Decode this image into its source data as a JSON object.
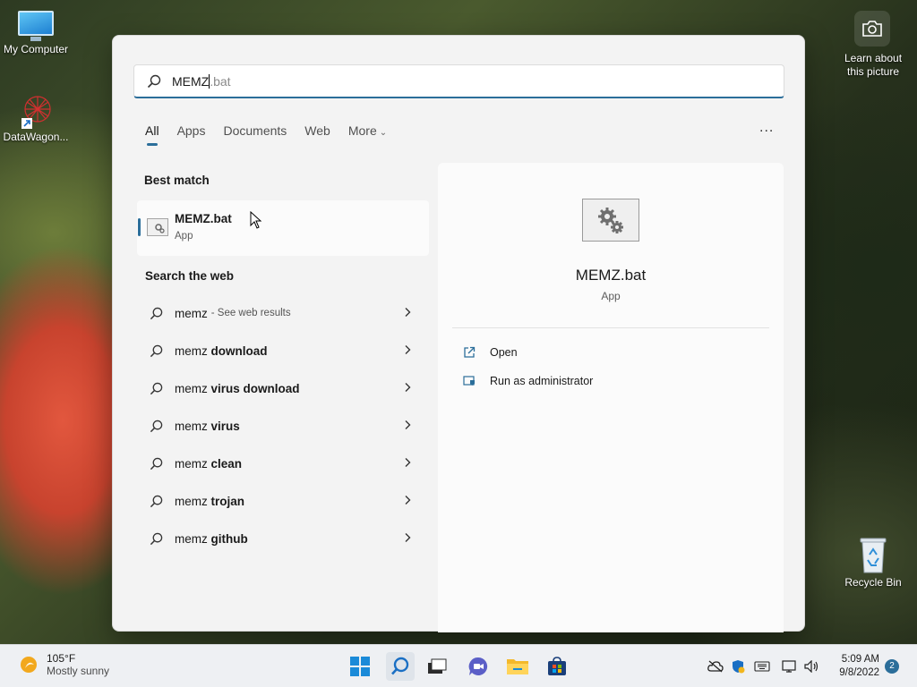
{
  "desktop": {
    "icons": [
      {
        "label": "My Computer"
      },
      {
        "label": "DataWagon..."
      },
      {
        "label": "Recycle Bin"
      }
    ],
    "camera": {
      "label_line1": "Learn about",
      "label_line2": "this picture"
    }
  },
  "search": {
    "typed": "MEMZ",
    "suggestion": ".bat",
    "tabs": [
      "All",
      "Apps",
      "Documents",
      "Web",
      "More"
    ],
    "active_tab": "All",
    "more_menu": "..."
  },
  "best_match": {
    "heading": "Best match",
    "name": "MEMZ.bat",
    "type": "App"
  },
  "web": {
    "heading": "Search the web",
    "results": [
      {
        "query": "memz",
        "bold": "",
        "hint": "- See web results"
      },
      {
        "query": "memz ",
        "bold": "download",
        "hint": ""
      },
      {
        "query": "memz ",
        "bold": "virus download",
        "hint": ""
      },
      {
        "query": "memz ",
        "bold": "virus",
        "hint": ""
      },
      {
        "query": "memz ",
        "bold": "clean",
        "hint": ""
      },
      {
        "query": "memz ",
        "bold": "trojan",
        "hint": ""
      },
      {
        "query": "memz ",
        "bold": "github",
        "hint": ""
      }
    ]
  },
  "detail": {
    "title": "MEMZ.bat",
    "type": "App",
    "actions": [
      {
        "label": "Open",
        "icon": "open-icon"
      },
      {
        "label": "Run as administrator",
        "icon": "admin-shield-icon"
      }
    ]
  },
  "taskbar": {
    "weather": {
      "temp": "105°F",
      "condition": "Mostly sunny"
    },
    "apps": [
      "start-icon",
      "search-icon",
      "task-view-icon",
      "chat-icon",
      "file-explorer-icon",
      "store-icon"
    ],
    "clock": {
      "time": "5:09 AM",
      "date": "9/8/2022"
    },
    "notifications": "2"
  },
  "colors": {
    "accent": "#2b6e9a",
    "panel": "#f3f3f3"
  }
}
